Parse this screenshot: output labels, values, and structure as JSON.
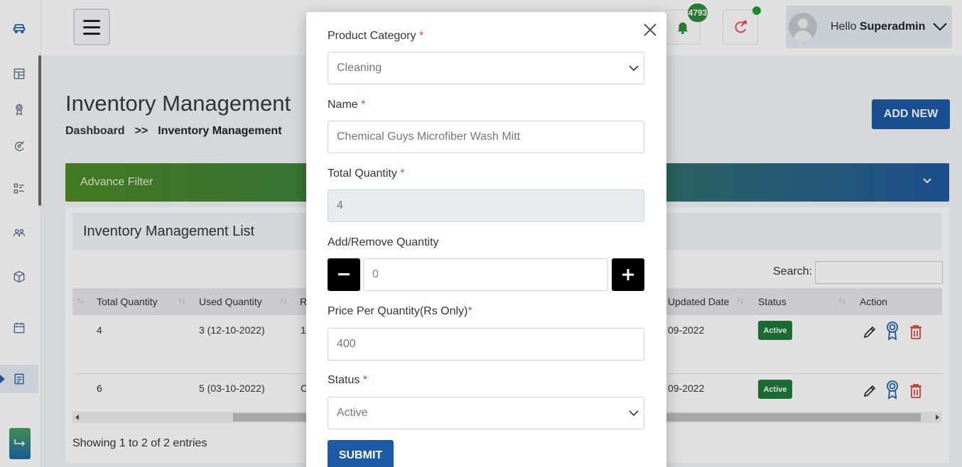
{
  "header": {
    "notification_count": "4793",
    "greeting": "Hello",
    "username": "Superadmin"
  },
  "page": {
    "title": "Inventory Management",
    "breadcrumb": {
      "home": "Dashboard",
      "separator": ">>",
      "current": "Inventory Management"
    },
    "add_new_label": "ADD NEW",
    "filter_label": "Advance Filter",
    "list_title": "Inventory Management List",
    "search_label": "Search:",
    "entries_info": "Showing 1 to 2 of 2 entries"
  },
  "table": {
    "columns": [
      "Total Quantity",
      "Used Quantity",
      "R",
      "Updated Date",
      "Status",
      "Action"
    ],
    "rows": [
      {
        "total_quantity": "4",
        "used_quantity": "3 (12-10-2022)",
        "r": "1",
        "updated_date": "09-2022",
        "status": "Active"
      },
      {
        "total_quantity": "6",
        "used_quantity": "5 (03-10-2022)",
        "r": "C",
        "updated_date": "09-2022",
        "status": "Active"
      }
    ]
  },
  "modal": {
    "category_label": "Product Category",
    "category_value": "Cleaning",
    "name_label": "Name",
    "name_value": "Chemical Guys Microfiber Wash Mitt",
    "total_qty_label": "Total Quantity",
    "total_qty_value": "4",
    "add_remove_label": "Add/Remove Quantity",
    "add_remove_value": "0",
    "price_label": "Price Per Quantity(Rs Only)",
    "price_value": "400",
    "status_label": "Status",
    "status_value": "Active",
    "required_mark": "*",
    "submit_label": "SUBMIT"
  },
  "colors": {
    "primary": "#1c5aa5",
    "filter_gradient_start": "#4c8a26",
    "filter_gradient_end": "#215aa0",
    "status_active": "#1f7a3a",
    "required": "#e0443e"
  },
  "icons": {
    "sidebar": [
      "car-icon",
      "dashboard-icon",
      "award-icon",
      "service-icon",
      "list-icon",
      "users-icon",
      "box-icon",
      "calendar-icon",
      "inventory-icon"
    ],
    "header": [
      "menu-icon",
      "bell-icon",
      "rocket-icon",
      "chevron-down-icon"
    ],
    "actions": [
      "edit-icon",
      "award-icon",
      "trash-icon"
    ]
  }
}
